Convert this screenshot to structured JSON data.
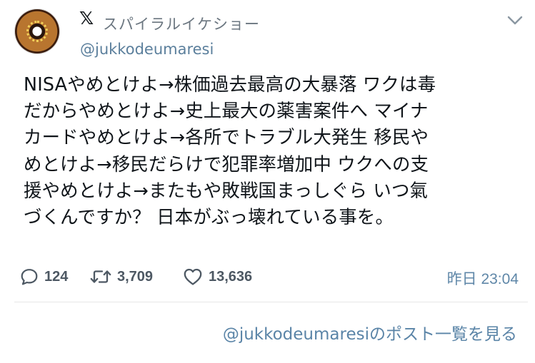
{
  "user": {
    "display_name": "スパイラルイケショー",
    "handle": "@jukkodeumaresi",
    "avatar_icon": "donut-avatar"
  },
  "tweet": {
    "text": "NISAやめとけよ→株価過去最高の大暴落 ワクは毒\nだからやめとけよ→史上最大の薬害案件へ マイナ\nカードやめとけよ→各所でトラブル大発生 移民や\nめとけよ→移民だらけで犯罪率増加中 ウクへの支\n援やめとけよ→またもや敗戦国まっしぐら いつ氣\nづくんですか？ 日本がぶっ壊れている事を。"
  },
  "actions": {
    "reply_count": "124",
    "retweet_count": "3,709",
    "like_count": "13,636",
    "timestamp": "昨日 23:04"
  },
  "footer": {
    "link_text": "@jukkodeumaresiのポスト一覧を見る"
  },
  "colors": {
    "text": "#0f1419",
    "muted": "#6b7680",
    "link": "#5a84a7"
  },
  "icons": [
    "x-logo-icon",
    "chevron-down-icon",
    "reply-icon",
    "retweet-icon",
    "like-icon"
  ]
}
